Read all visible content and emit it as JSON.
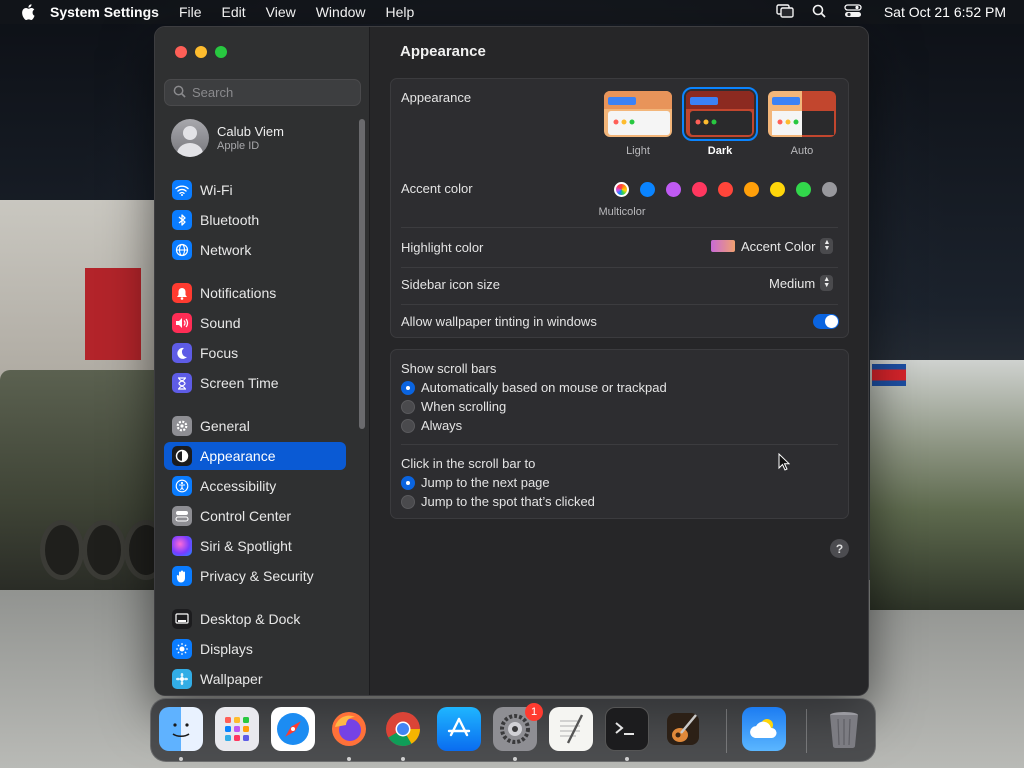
{
  "menubar": {
    "app_name": "System Settings",
    "menus": [
      "File",
      "Edit",
      "View",
      "Window",
      "Help"
    ],
    "clock": "Sat Oct 21  6:52 PM"
  },
  "sidebar": {
    "search_placeholder": "Search",
    "account": {
      "name": "Calub Viem",
      "subtitle": "Apple ID"
    },
    "items": [
      {
        "label": "Wi-Fi",
        "icon": "wifi-icon",
        "color": "#0a7cff"
      },
      {
        "label": "Bluetooth",
        "icon": "bluetooth-icon",
        "color": "#0a7cff"
      },
      {
        "label": "Network",
        "icon": "globe-icon",
        "color": "#0a7cff"
      },
      {
        "label": "Notifications",
        "icon": "bell-icon",
        "color": "#ff3b30"
      },
      {
        "label": "Sound",
        "icon": "speaker-icon",
        "color": "#ff2d55"
      },
      {
        "label": "Focus",
        "icon": "moon-icon",
        "color": "#5e5ce6"
      },
      {
        "label": "Screen Time",
        "icon": "hourglass-icon",
        "color": "#5e5ce6"
      },
      {
        "label": "General",
        "icon": "gear-icon",
        "color": "#8e8e93"
      },
      {
        "label": "Appearance",
        "icon": "appearance-icon",
        "color": "#1c1c1e"
      },
      {
        "label": "Accessibility",
        "icon": "accessibility-icon",
        "color": "#0a7cff"
      },
      {
        "label": "Control Center",
        "icon": "control-center-icon",
        "color": "#8e8e93"
      },
      {
        "label": "Siri & Spotlight",
        "icon": "siri-icon",
        "color": "#a23cff"
      },
      {
        "label": "Privacy & Security",
        "icon": "hand-icon",
        "color": "#0a7cff"
      },
      {
        "label": "Desktop & Dock",
        "icon": "desktop-icon",
        "color": "#1c1c1e"
      },
      {
        "label": "Displays",
        "icon": "display-icon",
        "color": "#0a7cff"
      },
      {
        "label": "Wallpaper",
        "icon": "wallpaper-icon",
        "color": "#32ade6"
      }
    ],
    "active_item": "Appearance"
  },
  "main": {
    "title": "Appearance",
    "appearance": {
      "label": "Appearance",
      "options": [
        "Light",
        "Dark",
        "Auto"
      ],
      "selected": "Dark"
    },
    "accent": {
      "label": "Accent color",
      "caption": "Multicolor",
      "colors": [
        "#8e8e93",
        "#0a84ff",
        "#bf5af2",
        "#ff375f",
        "#ff453a",
        "#ff9f0a",
        "#ffd60a",
        "#32d74b",
        "#98989d"
      ]
    },
    "highlight": {
      "label": "Highlight color",
      "value": "Accent Color"
    },
    "sidebar_icon_size": {
      "label": "Sidebar icon size",
      "value": "Medium"
    },
    "wallpaper_tinting": {
      "label": "Allow wallpaper tinting in windows",
      "on": true
    },
    "scroll_bars": {
      "label": "Show scroll bars",
      "options": [
        "Automatically based on mouse or trackpad",
        "When scrolling",
        "Always"
      ],
      "selected": "Automatically based on mouse or trackpad"
    },
    "click_scroll": {
      "label": "Click in the scroll bar to",
      "options": [
        "Jump to the next page",
        "Jump to the spot that’s clicked"
      ],
      "selected": "Jump to the next page"
    },
    "help": "?"
  },
  "dock": {
    "apps": [
      "Finder",
      "Launchpad",
      "Safari",
      "Firefox",
      "Chrome",
      "App Store",
      "System Settings",
      "TextEdit",
      "Terminal",
      "GarageBand",
      "Weather",
      "Trash"
    ],
    "badge": "1"
  }
}
